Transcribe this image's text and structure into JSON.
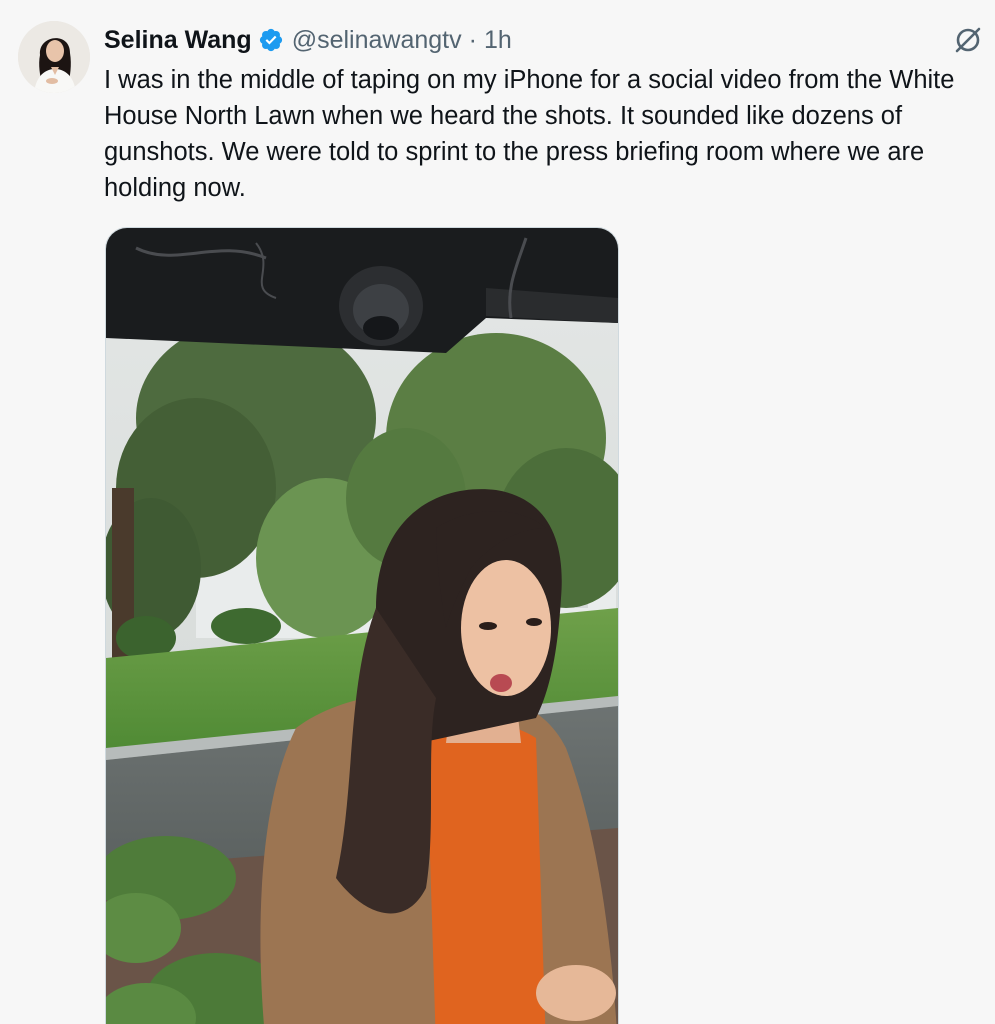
{
  "author": {
    "display_name": "Selina Wang",
    "handle": "@selinawangtv",
    "separator": "·",
    "timestamp": "1h",
    "verified": true
  },
  "tweet": {
    "text": "I was in the middle of taping on my iPhone for a social video from the White House North Lawn when we heard the shots. It sounded like dozens of gunshots. We were told to sprint to the press briefing room where we are holding now."
  },
  "icons": {
    "verified": "verified-badge-icon",
    "grok": "grok-icon"
  },
  "colors": {
    "verified_blue": "#1d9bf0",
    "secondary_text": "#536471",
    "primary_text": "#0f1419"
  }
}
